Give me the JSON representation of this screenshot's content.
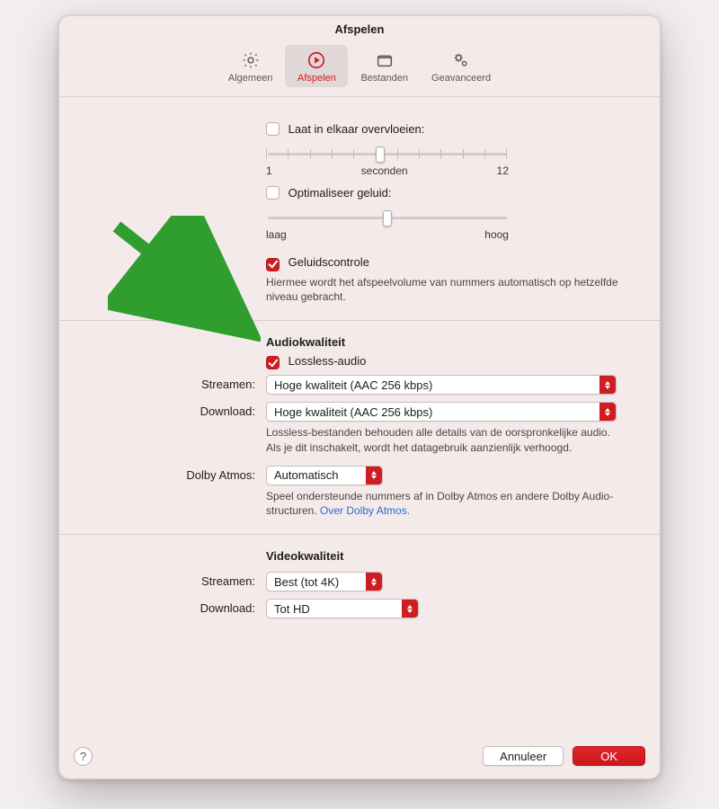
{
  "window": {
    "title": "Afspelen"
  },
  "toolbar": {
    "general": {
      "label": "Algemeen"
    },
    "playback": {
      "label": "Afspelen"
    },
    "files": {
      "label": "Bestanden"
    },
    "advanced": {
      "label": "Geavanceerd"
    }
  },
  "crossfade": {
    "label": "Laat in elkaar overvloeien:",
    "min": "1",
    "mid": "seconden",
    "max": "12"
  },
  "optimize": {
    "label": "Optimaliseer geluid:",
    "low": "laag",
    "high": "hoog"
  },
  "soundcheck": {
    "label": "Geluidscontrole",
    "desc": "Hiermee wordt het afspeelvolume van nummers automatisch op hetzelfde niveau gebracht."
  },
  "audio": {
    "heading": "Audiokwaliteit",
    "lossless_label": "Lossless-audio",
    "stream_label": "Streamen:",
    "stream_value": "Hoge kwaliteit (AAC 256 kbps)",
    "download_label": "Download:",
    "download_value": "Hoge kwaliteit (AAC 256 kbps)",
    "desc": "Lossless-bestanden behouden alle details van de oorspronkelijke audio. Als je dit inschakelt, wordt het datagebruik aanzienlijk verhoogd.",
    "dolby_label": "Dolby Atmos:",
    "dolby_value": "Automatisch",
    "dolby_desc": "Speel ondersteunde nummers af in Dolby Atmos en andere Dolby Audio-structuren. ",
    "dolby_link": "Over Dolby Atmos."
  },
  "video": {
    "heading": "Videokwaliteit",
    "stream_label": "Streamen:",
    "stream_value": "Best (tot 4K)",
    "download_label": "Download:",
    "download_value": "Tot HD"
  },
  "footer": {
    "help": "?",
    "cancel": "Annuleer",
    "ok": "OK"
  }
}
